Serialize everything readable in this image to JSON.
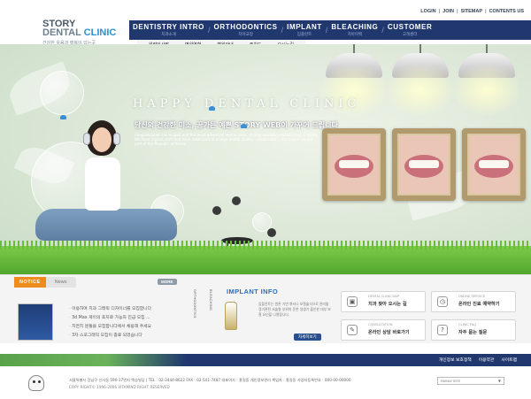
{
  "logo": {
    "line1": "STORY",
    "line2_a": "DENTAL ",
    "line2_b": "CLINIC",
    "tagline": "건강한 웃음과 행복이 있는곳"
  },
  "top_links": [
    "LOGIN",
    "JOIN",
    "SITEMAP",
    "CONTENTS US"
  ],
  "nav": [
    {
      "en": "DENTISTRY INTRO",
      "ko": "치과소개"
    },
    {
      "en": "ORTHODONTICS",
      "ko": "치아교정"
    },
    {
      "en": "IMPLANT",
      "ko": "임플란트"
    },
    {
      "en": "BLEACHING",
      "ko": "치아미백"
    },
    {
      "en": "CUSTOMER",
      "ko": "고객센터"
    }
  ],
  "subnav": [
    "원장인사말",
    "병원연혁",
    "병원안내",
    "주치도",
    "오시는길"
  ],
  "hero": {
    "title": "HAPPY DENTAL CLINIC",
    "subtitle": "당신의 건강한 미소, 꿈가든 예쁜 STORY WEB이 가꾸어 드립니다",
    "desc": "Congratulation the largest and the most advanced dental clinic, strong reputation  established in Korea. We have a great staff that have taken part in a large dental studies collaboratory, the largest dental part of the Republic of Korea."
  },
  "notice": {
    "tab_notice": "NOTICE",
    "tab_news": "News",
    "more": "MORE",
    "items": [
      "이용하여 치과 그래픽 디자이너를 모집합니다",
      "3d Max 게이의 포지로 가능자 진급 모집 ...",
      "치면치 분들을 모집합니다에서 채용해 주세요",
      "3차 스포그래익 모집이 종료 되었습니다"
    ]
  },
  "vlabels": [
    "ORTHODONTICS",
    "BLEACHING"
  ],
  "implant": {
    "title": "IMPLANT INFO",
    "desc": "임플란트는 원론 기반 뿌리나 보철술식으로 관리될 경기관된 서술형 부위의 운찬 생생기 출인한 대부 보철 요인을 나열합니다.",
    "button": "자세히보기"
  },
  "services": [
    {
      "en": "DENTAL CLINIC MAP",
      "ko": "치과 찾아 오시는 길",
      "icon": "bus-icon",
      "glyph": "▣"
    },
    {
      "en": "ONLINE SERVICE",
      "ko": "온라인 진료 예약하기",
      "icon": "calendar-icon",
      "glyph": "◷"
    },
    {
      "en": "CONSULTATION",
      "ko": "온라인 상담 바로가기",
      "icon": "chat-icon",
      "glyph": "✎"
    },
    {
      "en": "CLINIC FAQ",
      "ko": "자주 묻는 질문",
      "icon": "question-icon",
      "glyph": "?"
    }
  ],
  "footer": {
    "links": [
      "개인정보 보호정책",
      "이용약관",
      "사이트맵"
    ],
    "address": "서울특별시 강남구 신사동 590-17번지 백승빌딩 | TEL : 02-3444-8622  FAX : 02-541-7487   대표이사 : 홍길동   개인정보관리 책임자 : 홍길동   사업자등록번호 : 000-00-00000",
    "copyright": "COPY RIGHT© 1996-2006 VITAMIND RIGHT RESERVED",
    "family_site": "FAMILY SITE",
    "family_arrow": "▼"
  },
  "colors": {
    "nav_bg": "#20386e",
    "notice_tab": "#ef8c1f",
    "implant_title": "#2a6dbf",
    "grass": "#6cbc3c"
  }
}
